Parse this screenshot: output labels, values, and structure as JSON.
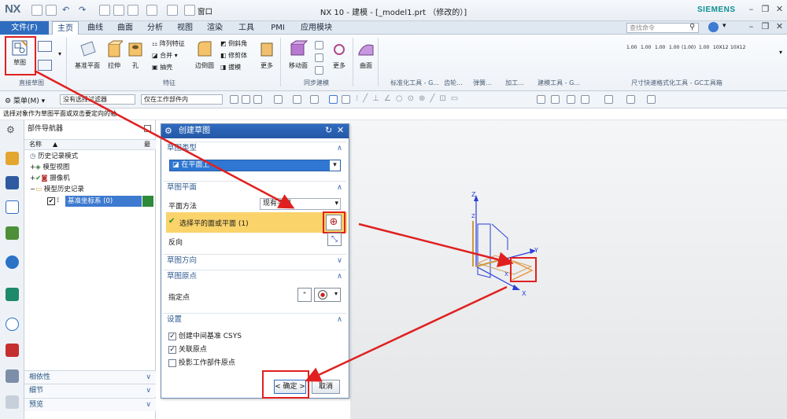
{
  "titlebar": {
    "logo": "NX",
    "quick_menu": "窗口",
    "title": "NX 10 - 建模 - [_model1.prt （修改的）]",
    "brand": "SIEMENS"
  },
  "menubar": {
    "file": "文件(F)",
    "tabs": [
      "主页",
      "曲线",
      "曲面",
      "分析",
      "视图",
      "渲染",
      "工具",
      "PMI",
      "应用模块"
    ],
    "search_placeholder": "查找命令"
  },
  "ribbon": {
    "sketch": "草图",
    "datum_plane": "基准平面",
    "extrude": "拉伸",
    "hole": "孔",
    "pattern": "阵列特征",
    "unite": "合并",
    "shell": "抽壳",
    "edge_blend": "边倒圆",
    "chamfer": "倒斜角",
    "trim_body": "修剪体",
    "draft": "拔模",
    "more1": "更多",
    "move_face": "移动面",
    "more2": "更多",
    "surface": "曲面",
    "groups": {
      "direct_sketch": "直接草图",
      "feature": "特征",
      "sync": "同步建模",
      "std_tool": "标准化工具 - G...",
      "gear": "齿轮...",
      "spring": "弹簧...",
      "machining": "加工...",
      "build_tool": "建模工具 - G...",
      "dim_tool": "尺寸快速格式化工具 - GC工具箱"
    },
    "dim_labels": [
      "1.00",
      "1.00",
      "1.00",
      "1.00",
      "(1.00)",
      "1.00",
      "10X12",
      "10X12"
    ]
  },
  "toolbar": {
    "menu": "菜单(M)",
    "filter": "没有选择过滤器",
    "scope": "仅在工作部件内"
  },
  "status": "选择对象作为草图平面或双击要定向的轴",
  "navigator": {
    "title": "部件导航器",
    "col_name": "名称",
    "col_latest": "最",
    "rows": [
      "历史记录模式",
      "模型视图",
      "摄像机",
      "模型历史记录",
      "基准坐标系 (0)"
    ],
    "sections": [
      "相依性",
      "细节",
      "预览"
    ]
  },
  "dialog": {
    "title": "创建草图",
    "sec_type": "草图类型",
    "type_value": "在平面上",
    "sec_plane": "草图平面",
    "plane_method_label": "平面方法",
    "plane_method_value": "现有平面",
    "select_face": "选择平的面或平面 (1)",
    "reverse": "反向",
    "sec_orient": "草图方向",
    "sec_origin": "草图原点",
    "specify_point": "指定点",
    "sec_settings": "设置",
    "opt1": "创建中间基准 CSYS",
    "opt2": "关联原点",
    "opt3": "投影工作部件原点",
    "ok": "< 确定 >",
    "cancel": "取消"
  },
  "axes": {
    "x": "X",
    "y": "Y",
    "z": "Z",
    "z2": "Z",
    "x2": "X"
  },
  "colors": {
    "accent": "#2e6cc0",
    "highlight": "#fad36a",
    "annotation": "#e02020"
  }
}
